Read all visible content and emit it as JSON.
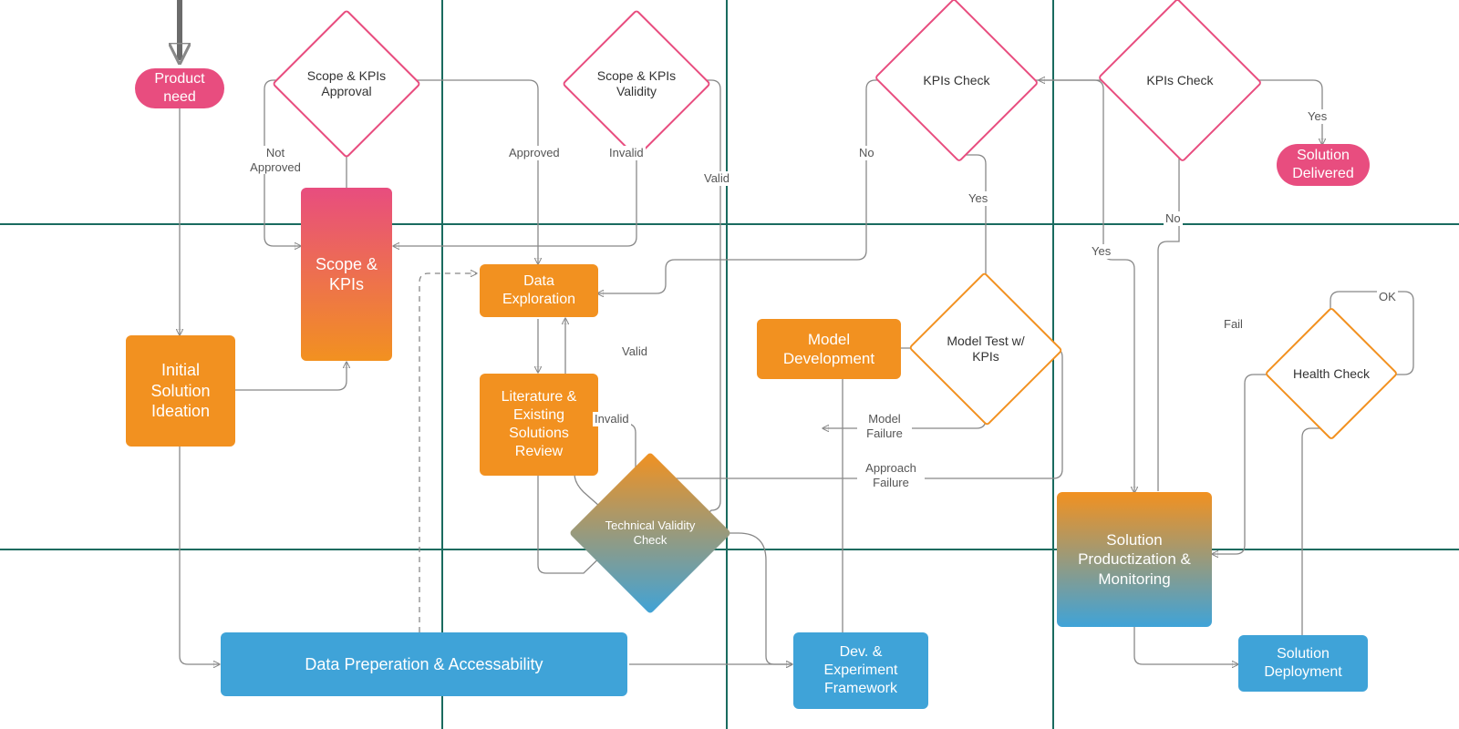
{
  "nodes": {
    "product_need": "Product need",
    "scope_kpis_approval": "Scope & KPIs Approval",
    "scope_kpis_validity": "Scope & KPIs Validity",
    "kpis_check_1": "KPIs Check",
    "kpis_check_2": "KPIs Check",
    "solution_delivered": "Solution Delivered",
    "scope_kpis": "Scope & KPIs",
    "initial_solution_ideation": "Initial Solution Ideation",
    "data_exploration": "Data Exploration",
    "lit_review": "Literature & Existing Solutions Review",
    "model_development": "Model Development",
    "model_test_kpis": "Model Test w/ KPIs",
    "health_check": "Health Check",
    "tech_validity": "Technical Validity Check",
    "data_prep": "Data Preperation & Accessability",
    "dev_framework": "Dev. & Experiment Framework",
    "solution_prod_mon": "Solution Productization & Monitoring",
    "solution_deploy": "Solution Deployment"
  },
  "labels": {
    "not_approved": "Not Approved",
    "approved": "Approved",
    "invalid": "Invalid",
    "valid": "Valid",
    "no": "No",
    "yes": "Yes",
    "fail": "Fail",
    "ok": "OK",
    "model_failure": "Model Failure",
    "approach_failure": "Approach Failure"
  },
  "colors": {
    "pink": "#e84d7f",
    "orange": "#f29120",
    "blue": "#3fa3d8",
    "grid": "#1a6b5f",
    "edge": "#888888"
  }
}
